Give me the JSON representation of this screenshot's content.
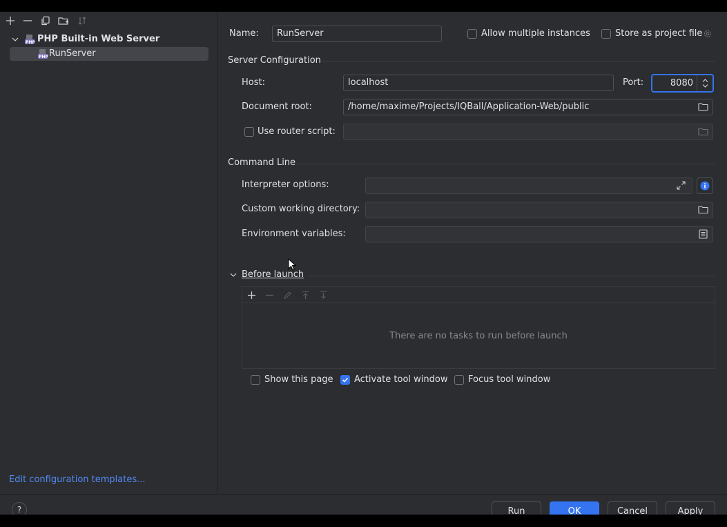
{
  "tree": {
    "root_label": "PHP Built-in Web Server",
    "child_label": "RunServer",
    "edit_templates_link": "Edit configuration templates..."
  },
  "form": {
    "name_label": "Name:",
    "name_value": "RunServer",
    "allow_multiple_label": "Allow multiple instances",
    "store_project_label": "Store as project file",
    "server_config_title": "Server Configuration",
    "host_label": "Host:",
    "host_value": "localhost",
    "port_label": "Port:",
    "port_value": "8080",
    "docroot_label": "Document root:",
    "docroot_value": "/home/maxime/Projects/IQBall/Application-Web/public",
    "router_label": "Use router script:",
    "command_line_title": "Command Line",
    "interp_label": "Interpreter options:",
    "cwd_label": "Custom working directory:",
    "env_label": "Environment variables:",
    "before_launch_title": "Before launch",
    "no_tasks_text": "There are no tasks to run before launch",
    "show_page_label": "Show this page",
    "activate_tool_label": "Activate tool window",
    "focus_tool_label": "Focus tool window"
  },
  "buttons": {
    "run": "Run",
    "ok": "OK",
    "cancel": "Cancel",
    "apply": "Apply",
    "help": "?"
  },
  "colors": {
    "accent": "#3574f0",
    "background": "#2b2d30",
    "link": "#548af7"
  }
}
